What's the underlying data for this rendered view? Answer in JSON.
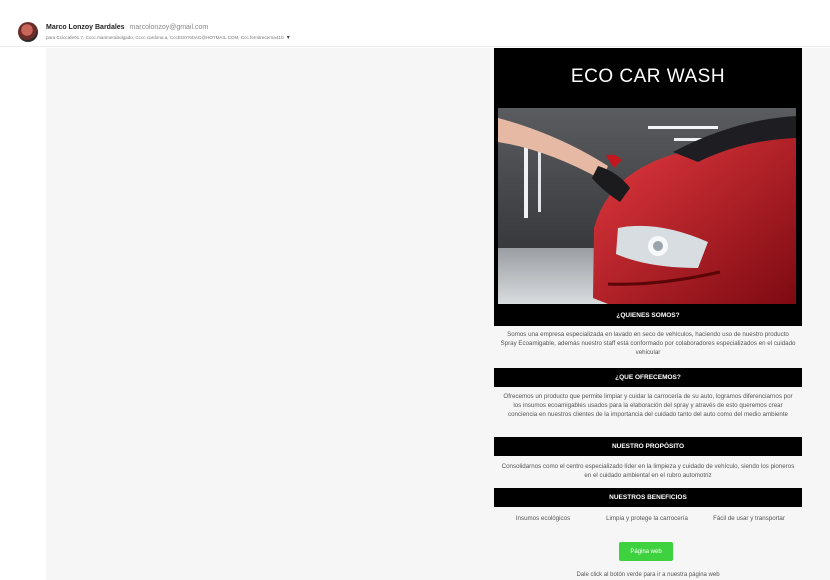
{
  "email": {
    "sender_name": "Marco Lonzoy Bardales",
    "sender_email": "marcolonzoy@gmail.com",
    "recipients": "para Cciccafe01.7, Cccc.marimerabolgado, Cccc.cardona.a, CccEISYNDAC@HOTMAIL.COM, Ccc.fernitrecerna410"
  },
  "newsletter": {
    "title": "ECO CAR WASH",
    "sections": [
      {
        "heading": "¿QUIENES SOMOS?",
        "body": "Somos una empresa especializada en lavado en seco de vehículos, haciendo uso de nuestro producto Spray Ecoamigable, además nuestro staff está conformado por colaboradores especializados en el cuidado vehicular"
      },
      {
        "heading": "¿QUE OFRECEMOS?",
        "body": "Ofrecemos un producto que permite limpiar y cuidar la carrocería de su auto, logramos diferenciarnos por los insumos ecoamigables usados para la elaboración del spray y através de esto queremos crear conciencia en nuestros clientes de la importancia del cuidado tanto del auto como del medio ambiente"
      },
      {
        "heading": "NUESTRO PROPÓSITO",
        "body": "Consolidarnos como el centro especializado líder en la limpieza y cuidado de vehículo, siendo los pioneros en el cuidado ambiental en el rubro automotriz"
      },
      {
        "heading": "NUESTROS BENEFICIOS",
        "body": ""
      }
    ],
    "benefits": [
      "Insumos ecológicos",
      "Limpia y protege la carrocería",
      "Fácil de usar y transportar"
    ],
    "button_label": "Página web",
    "footnote": "Dale click al botón verde para ir a nuestra página web"
  },
  "colors": {
    "header_bar": "#000000",
    "button": "#3ed33e",
    "car": "#b3121b"
  }
}
